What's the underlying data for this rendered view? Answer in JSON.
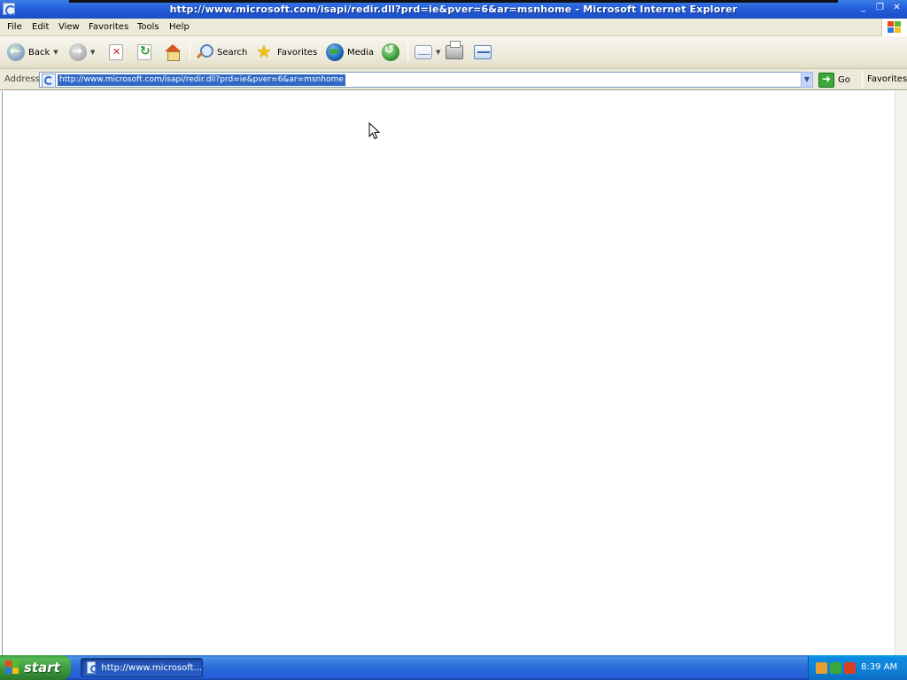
{
  "window": {
    "title": "http://www.microsoft.com/isapi/redir.dll?prd=ie&pver=6&ar=msnhome - Microsoft Internet Explorer"
  },
  "menu": {
    "items": [
      "File",
      "Edit",
      "View",
      "Favorites",
      "Tools",
      "Help"
    ]
  },
  "toolbar": {
    "back_label": "Back",
    "search_label": "Search",
    "favorites_label": "Favorites",
    "media_label": "Media"
  },
  "address": {
    "label": "Address",
    "url": "http://www.microsoft.com/isapi/redir.dll?prd=ie&pver=6&ar=msnhome",
    "go_label": "Go",
    "links_label": "Favorites"
  },
  "taskbar": {
    "start_label": "start",
    "task_label": "http://www.microsoft...",
    "clock": "8:39 AM"
  },
  "colors": {
    "titlebar": "#245edb",
    "chrome": "#ece9d8",
    "selection": "#316ac5",
    "start": "#3c963c"
  }
}
